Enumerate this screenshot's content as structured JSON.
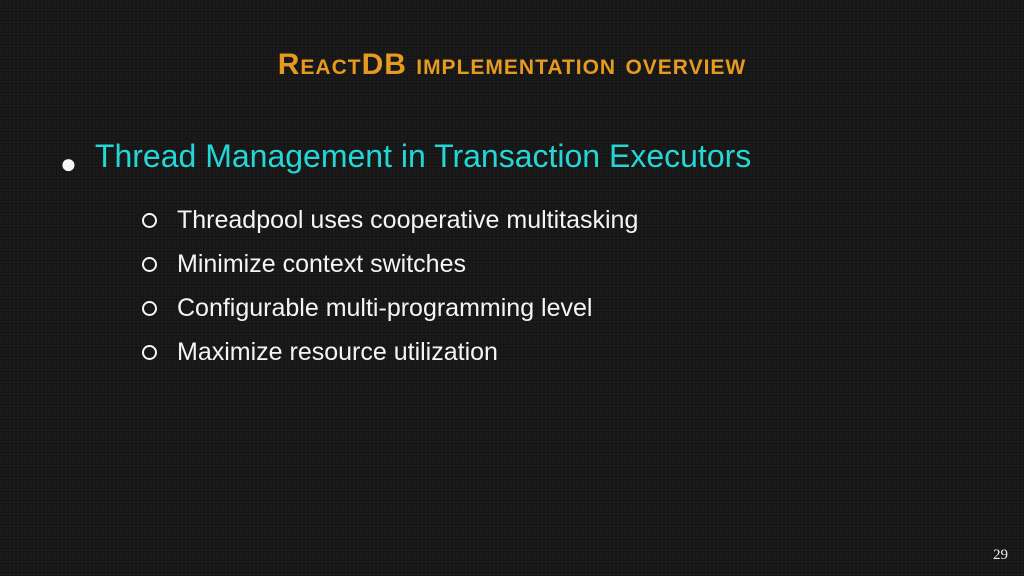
{
  "title": "ReactDB implementation overview",
  "mainBullet": "Thread Management in Transaction Executors",
  "subBullets": [
    "Threadpool uses cooperative multitasking",
    "Minimize context switches",
    "Configurable multi-programming level",
    "Maximize resource utilization"
  ],
  "pageNumber": "29"
}
